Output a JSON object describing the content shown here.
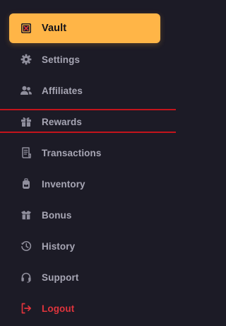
{
  "menu": {
    "active": {
      "label": "Vault",
      "icon": "vault-icon"
    },
    "items": [
      {
        "label": "Settings",
        "icon": "gear-icon"
      },
      {
        "label": "Affiliates",
        "icon": "users-icon"
      },
      {
        "label": "Rewards",
        "icon": "gift-icon"
      },
      {
        "label": "Transactions",
        "icon": "receipt-icon"
      },
      {
        "label": "Inventory",
        "icon": "backpack-icon"
      },
      {
        "label": "Bonus",
        "icon": "box-icon"
      },
      {
        "label": "History",
        "icon": "history-icon"
      },
      {
        "label": "Support",
        "icon": "headset-icon"
      },
      {
        "label": "Logout",
        "icon": "logout-icon"
      }
    ]
  },
  "colors": {
    "background": "#1c1b26",
    "accent": "#ffb547",
    "text": "#a7a6b4",
    "icon": "#8f8e9c",
    "danger": "#e0343c",
    "highlight_border": "#c3141c"
  }
}
